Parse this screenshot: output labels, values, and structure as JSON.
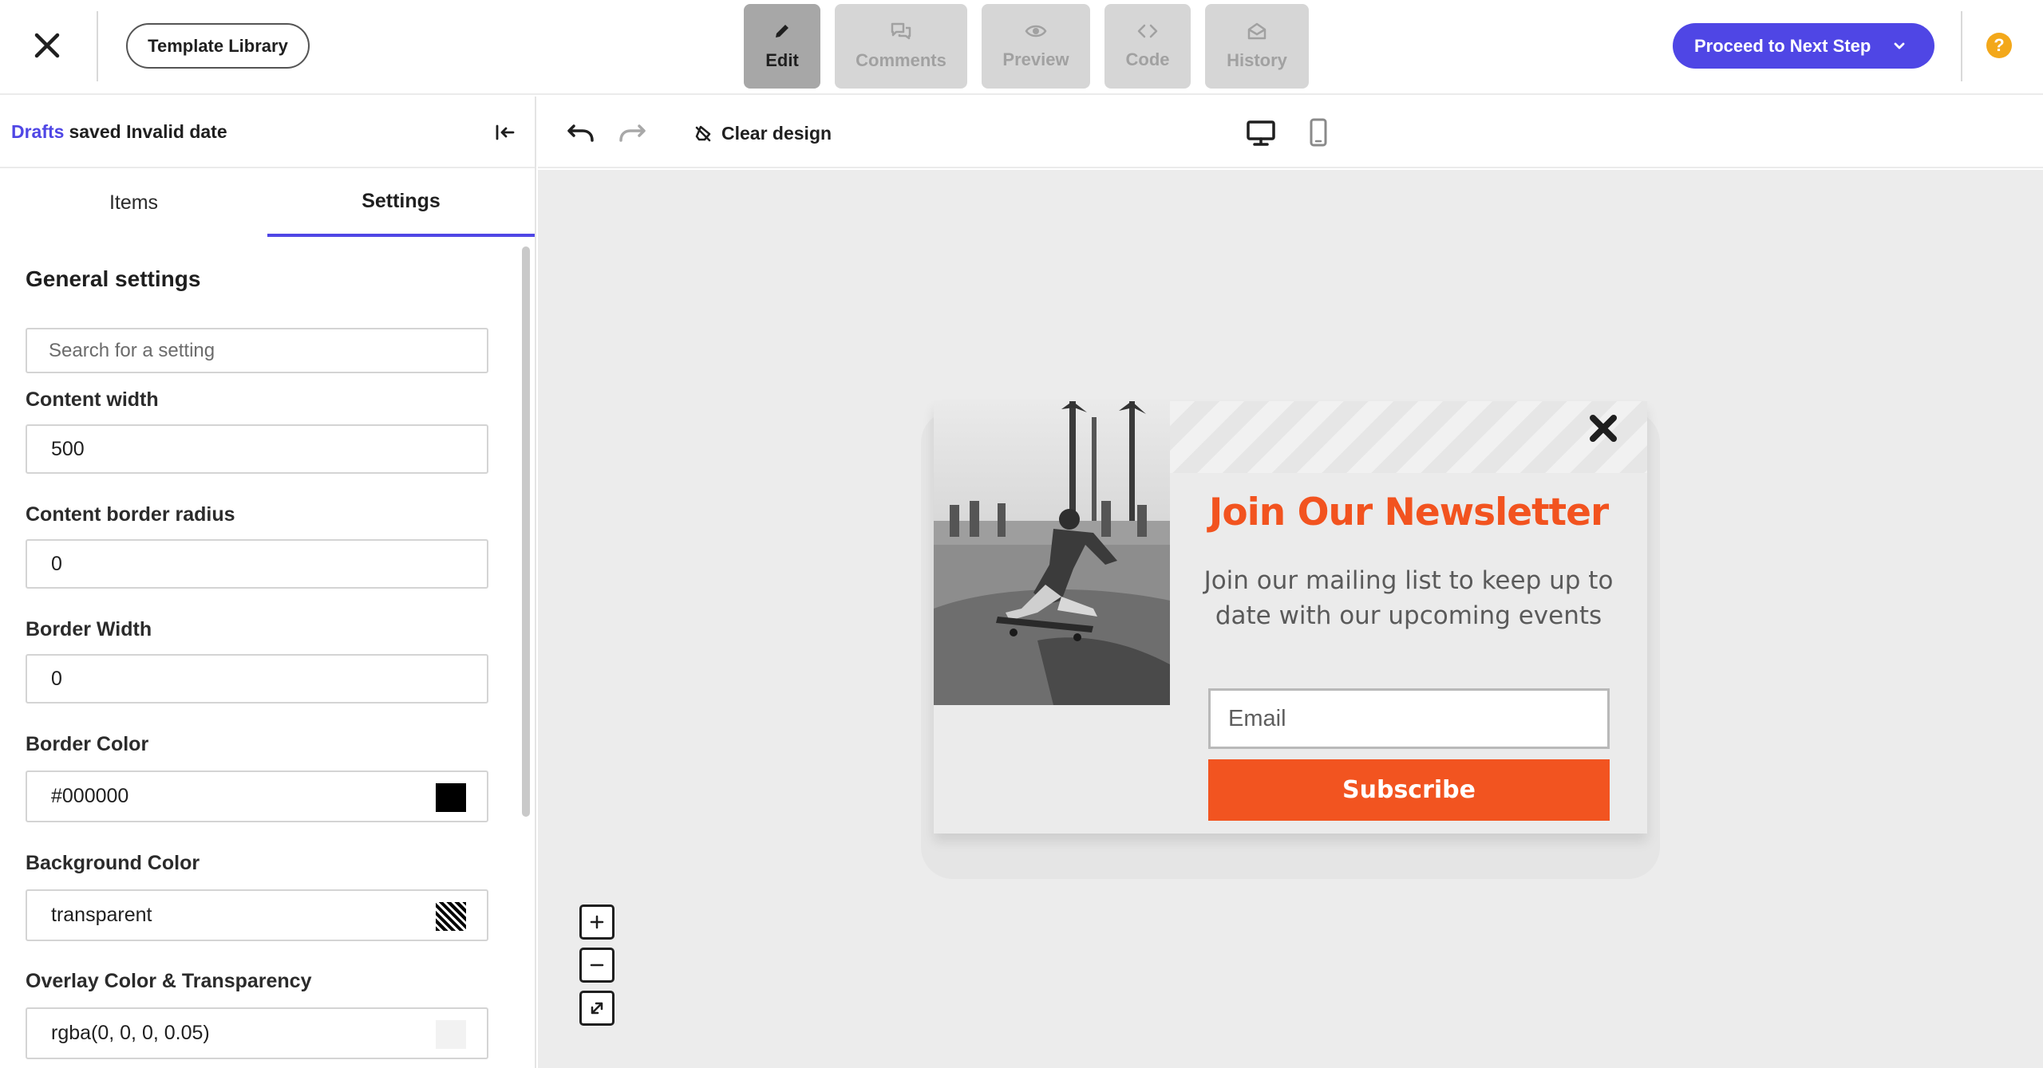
{
  "topbar": {
    "template_library_label": "Template Library",
    "modes": [
      {
        "label": "Edit",
        "icon": "pencil-icon",
        "active": true
      },
      {
        "label": "Comments",
        "icon": "comments-icon",
        "active": false
      },
      {
        "label": "Preview",
        "icon": "eye-icon",
        "active": false
      },
      {
        "label": "Code",
        "icon": "code-icon",
        "active": false
      },
      {
        "label": "History",
        "icon": "envelope-open-icon",
        "active": false
      }
    ],
    "proceed_label": "Proceed to Next Step",
    "help_label": "?"
  },
  "left_panel": {
    "drafts_link": "Drafts",
    "saved_text": "saved Invalid date",
    "tabs": [
      {
        "label": "Items",
        "active": false
      },
      {
        "label": "Settings",
        "active": true
      }
    ],
    "section_title": "General settings",
    "search_placeholder": "Search for a setting",
    "fields": {
      "content_width": {
        "label": "Content width",
        "value": "500"
      },
      "content_border_radius": {
        "label": "Content border radius",
        "value": "0"
      },
      "border_width": {
        "label": "Border Width",
        "value": "0"
      },
      "border_color": {
        "label": "Border Color",
        "value": "#000000"
      },
      "background_color": {
        "label": "Background Color",
        "value": "transparent"
      },
      "overlay_color": {
        "label": "Overlay Color & Transparency",
        "value": "rgba(0, 0, 0, 0.05)"
      }
    }
  },
  "canvas_toolbar": {
    "clear_design_label": "Clear design"
  },
  "popup": {
    "title": "Join Our Newsletter",
    "subtitle": "Join our mailing list to keep up to date with our upcoming events",
    "email_placeholder": "Email",
    "subscribe_label": "Subscribe"
  },
  "zoom": {
    "in_label": "+",
    "out_label": "−"
  },
  "colors": {
    "accent": "#4f46e5",
    "popup_accent": "#f25420",
    "help": "#f3a81a"
  }
}
